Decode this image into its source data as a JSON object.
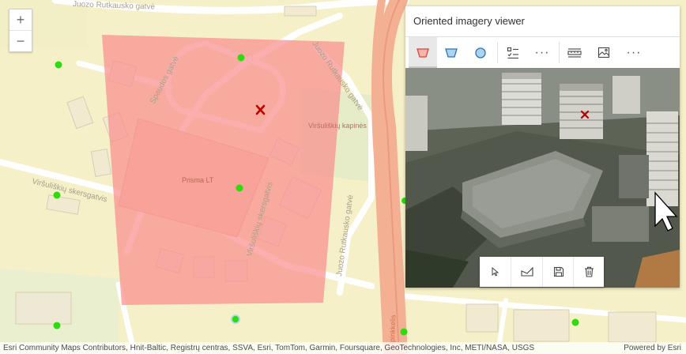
{
  "map": {
    "zoom_in_label": "+",
    "zoom_out_label": "−",
    "labels": {
      "street_top": "Juozo Rutkausko gatvė",
      "street_diag": "Juozo Rutkausko gatvė",
      "street_spaudos": "Spaudos gatvė",
      "street_skersgatvis_left": "Viršuliškių skersgatvis",
      "street_skersgatvis_mid": "Viršuliškių skersgatvis",
      "street_vertical": "Juozo Rutkausko gatvė",
      "cemetery": "Viršuliškių kapinės",
      "building": "Prisma LT",
      "ring_road": "apinkkelis",
      "ring_road_bottom": "apinkkelis"
    },
    "footprint_color": "#f98f8f",
    "marker_color": "#c00000",
    "point_color": "#2ddc0c"
  },
  "viewer": {
    "title": "Oriented imagery viewer",
    "toolbar": {
      "more_1": "···",
      "more_2": "···"
    },
    "image_tools": [
      "pointer",
      "measure",
      "save",
      "delete"
    ]
  },
  "attribution": {
    "text": "Esri Community Maps Contributors, Hnit-Baltic, Registrų centras, SSVA, Esri, TomTom, Garmin, Foursquare, GeoTechnologies, Inc, METI/NASA, USGS",
    "powered": "Powered by Esri"
  }
}
